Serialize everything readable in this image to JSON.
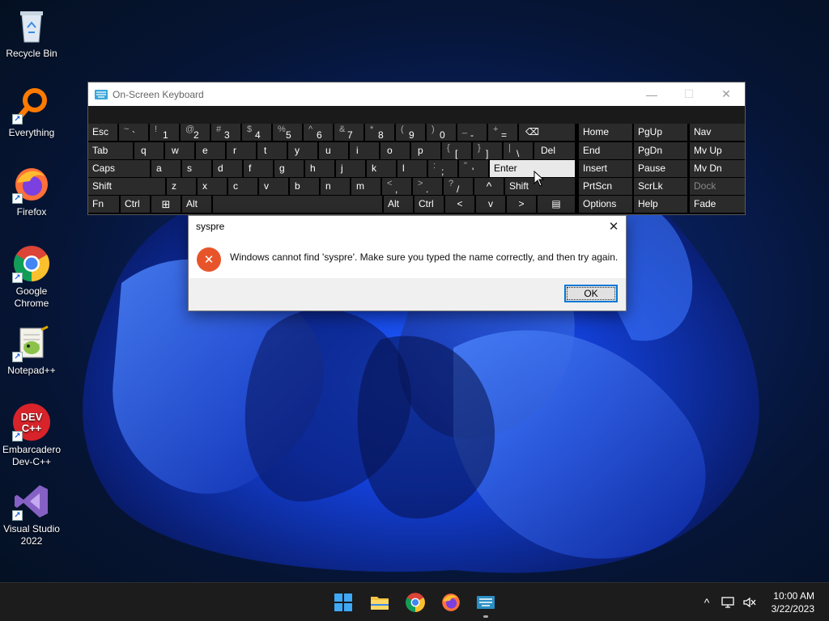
{
  "desktop": {
    "icons": [
      {
        "label": "Recycle Bin",
        "icon": "recycle-bin-icon",
        "shortcut": false
      },
      {
        "label": "Everything",
        "icon": "everything-search-icon",
        "shortcut": true
      },
      {
        "label": "Firefox",
        "icon": "firefox-icon",
        "shortcut": true
      },
      {
        "label": "Google Chrome",
        "icon": "chrome-icon",
        "shortcut": true
      },
      {
        "label": "Notepad++",
        "icon": "notepadpp-icon",
        "shortcut": true
      },
      {
        "label": "Embarcadero Dev-C++",
        "icon": "devcpp-icon",
        "shortcut": true
      },
      {
        "label": "Visual Studio 2022",
        "icon": "visual-studio-icon",
        "shortcut": true
      }
    ],
    "icon_logo_text": {
      "devcpp_top": "DEV",
      "devcpp_bottom": "C++"
    },
    "shortcut_glyph": "↗"
  },
  "osk": {
    "title": "On-Screen Keyboard",
    "window_controls": {
      "minimize": "—",
      "maximize": "☐",
      "close": "✕"
    },
    "rows": [
      [
        {
          "label": "Esc"
        },
        {
          "sub": "~",
          "main": "`"
        },
        {
          "sub": "!",
          "main": "1"
        },
        {
          "sub": "@",
          "main": "2"
        },
        {
          "sub": "#",
          "main": "3"
        },
        {
          "sub": "$",
          "main": "4"
        },
        {
          "sub": "%",
          "main": "5"
        },
        {
          "sub": "^",
          "main": "6"
        },
        {
          "sub": "&",
          "main": "7"
        },
        {
          "sub": "*",
          "main": "8"
        },
        {
          "sub": "(",
          "main": "9"
        },
        {
          "sub": ")",
          "main": "0"
        },
        {
          "sub": "_",
          "main": "-"
        },
        {
          "sub": "+",
          "main": "="
        },
        {
          "label": "⌫"
        }
      ],
      [
        {
          "label": "Tab"
        },
        {
          "label": "q"
        },
        {
          "label": "w"
        },
        {
          "label": "e"
        },
        {
          "label": "r"
        },
        {
          "label": "t"
        },
        {
          "label": "y"
        },
        {
          "label": "u"
        },
        {
          "label": "i"
        },
        {
          "label": "o"
        },
        {
          "label": "p"
        },
        {
          "sub": "{",
          "main": "["
        },
        {
          "sub": "}",
          "main": "]"
        },
        {
          "sub": "|",
          "main": "\\"
        },
        {
          "label": "Del"
        }
      ],
      [
        {
          "label": "Caps"
        },
        {
          "label": "a"
        },
        {
          "label": "s"
        },
        {
          "label": "d"
        },
        {
          "label": "f"
        },
        {
          "label": "g"
        },
        {
          "label": "h"
        },
        {
          "label": "j"
        },
        {
          "label": "k"
        },
        {
          "label": "l"
        },
        {
          "sub": ":",
          "main": ";"
        },
        {
          "sub": "\"",
          "main": "'"
        },
        {
          "label": "Enter"
        }
      ],
      [
        {
          "label": "Shift"
        },
        {
          "label": "z"
        },
        {
          "label": "x"
        },
        {
          "label": "c"
        },
        {
          "label": "v"
        },
        {
          "label": "b"
        },
        {
          "label": "n"
        },
        {
          "label": "m"
        },
        {
          "sub": "<",
          "main": ","
        },
        {
          "sub": ">",
          "main": "."
        },
        {
          "sub": "?",
          "main": "/"
        },
        {
          "label": "^"
        },
        {
          "label": "Shift"
        }
      ],
      [
        {
          "label": "Fn"
        },
        {
          "label": "Ctrl"
        },
        {
          "label": "⊞"
        },
        {
          "label": "Alt"
        },
        {
          "label": ""
        },
        {
          "label": "Alt"
        },
        {
          "label": "Ctrl"
        },
        {
          "label": "<"
        },
        {
          "label": "v"
        },
        {
          "label": ">"
        },
        {
          "label": "▤"
        }
      ]
    ],
    "nav_keys": [
      [
        "Home",
        "PgUp",
        "Nav"
      ],
      [
        "End",
        "PgDn",
        "Mv Up"
      ],
      [
        "Insert",
        "Pause",
        "Mv Dn"
      ],
      [
        "PrtScn",
        "ScrLk",
        "Dock"
      ],
      [
        "Options",
        "Help",
        "Fade"
      ]
    ]
  },
  "dialog": {
    "title": "syspre",
    "message": "Windows cannot find 'syspre'. Make sure you typed the name correctly, and then try again.",
    "ok_label": "OK",
    "close_glyph": "✕",
    "error_glyph": "✕"
  },
  "taskbar": {
    "apps": [
      "start-icon",
      "file-explorer-icon",
      "chrome-icon",
      "firefox-icon",
      "on-screen-keyboard-icon"
    ],
    "tray_chevron": "^",
    "time": "10:00 AM",
    "date": "3/22/2023"
  }
}
